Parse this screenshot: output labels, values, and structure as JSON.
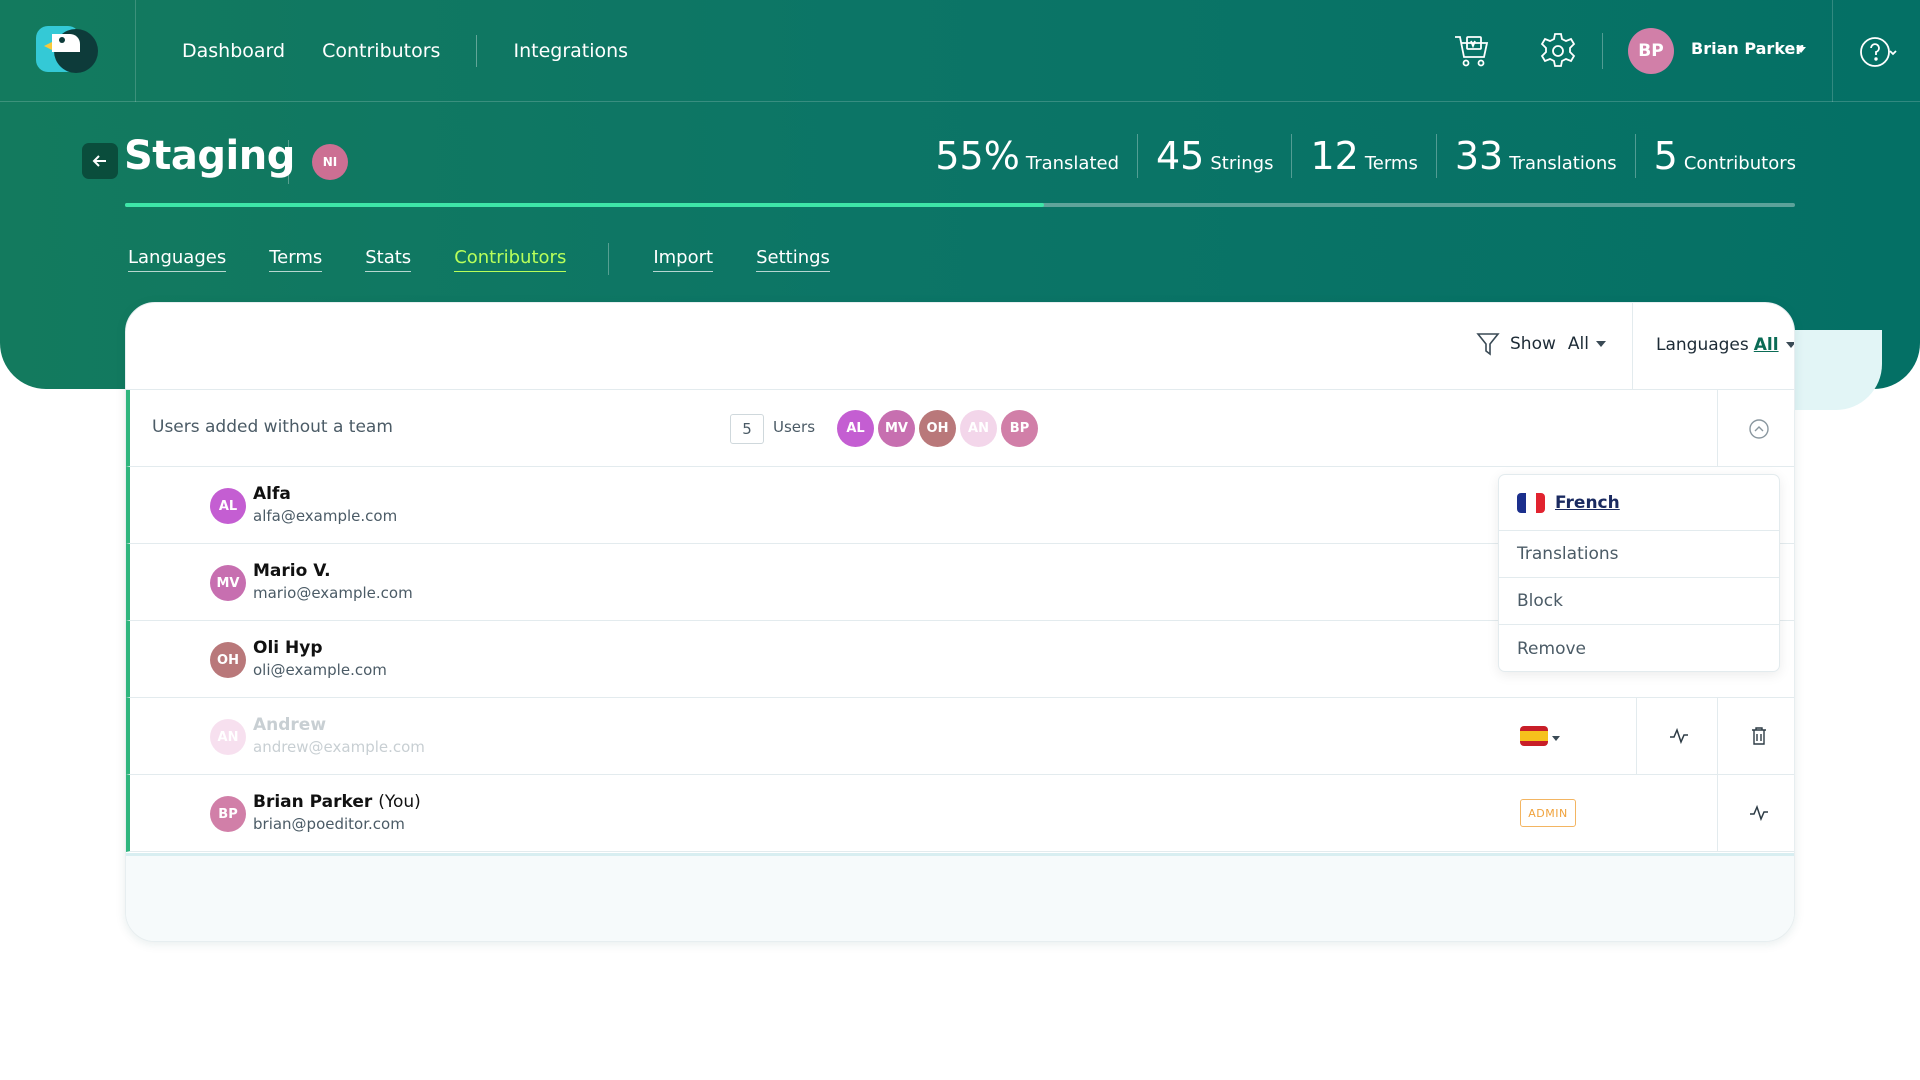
{
  "nav": {
    "links": [
      "Dashboard",
      "Contributors",
      "Integrations"
    ]
  },
  "user": {
    "initials": "BP",
    "name": "Brian Parker"
  },
  "project": {
    "title": "Staging",
    "badge": "NI",
    "progress_percent": 55
  },
  "stats": [
    {
      "value": "55%",
      "label": "Translated"
    },
    {
      "value": "45",
      "label": "Strings"
    },
    {
      "value": "12",
      "label": "Terms"
    },
    {
      "value": "33",
      "label": "Translations"
    },
    {
      "value": "5",
      "label": "Contributors"
    }
  ],
  "tabs": [
    "Languages",
    "Terms",
    "Stats",
    "Contributors",
    "Import",
    "Settings"
  ],
  "active_tab": "Contributors",
  "filters": {
    "show_label": "Show",
    "show_value": "All",
    "languages_label": "Languages",
    "languages_value": "All"
  },
  "team": {
    "title": "Users added without a team",
    "count": "5",
    "count_label": "Users",
    "avatars": [
      {
        "initials": "AL",
        "color": "#c45ed2"
      },
      {
        "initials": "MV",
        "color": "#c76fb0"
      },
      {
        "initials": "OH",
        "color": "#b9787a"
      },
      {
        "initials": "AN",
        "color": "#f3d6ea"
      },
      {
        "initials": "BP",
        "color": "#d17fa8"
      }
    ]
  },
  "members": [
    {
      "initials": "AL",
      "name": "Alfa",
      "email": "alfa@example.com",
      "color": "#c45ed2"
    },
    {
      "initials": "MV",
      "name": "Mario V.",
      "email": "mario@example.com",
      "color": "#c76fb0"
    },
    {
      "initials": "OH",
      "name": "Oli Hyp",
      "email": "oli@example.com",
      "color": "#b9787a"
    },
    {
      "initials": "AN",
      "name": "Andrew",
      "email": "andrew@example.com",
      "color": "#e9a9d2"
    },
    {
      "initials": "BP",
      "name": "Brian Parker",
      "you": "(You)",
      "email": "brian@poeditor.com",
      "color": "#d17fa8",
      "role": "ADMIN"
    }
  ],
  "popup": {
    "language": "French",
    "items": [
      "Translations",
      "Block",
      "Remove"
    ]
  },
  "colors": {
    "accent_green": "#2fb57e",
    "progress": "#3ee6a8",
    "active_tab": "#b8ff5a",
    "admin": "#f0a23c"
  }
}
